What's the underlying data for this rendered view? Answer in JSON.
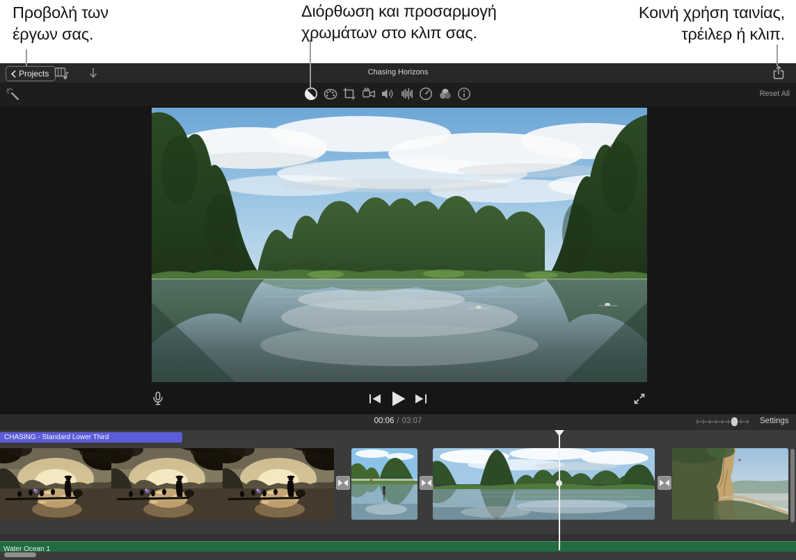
{
  "callouts": {
    "projects": {
      "line1": "Προβολή των",
      "line2": "έργων σας."
    },
    "color": {
      "line1": "Διόρθωση και προσαρμογή",
      "line2": "χρωμάτων στο κλιπ σας."
    },
    "share": {
      "line1": "Κοινή χρήση ταινίας,",
      "line2": "τρέιλερ ή κλιπ."
    }
  },
  "titlebar": {
    "back_label": "Projects",
    "project_title": "Chasing Horizons",
    "icons": [
      "back-chevron-icon",
      "media-browser-icon",
      "import-arrow-icon",
      "share-icon"
    ]
  },
  "adjustbar": {
    "reset_label": "Reset All",
    "icons": [
      "enhance-wand-icon",
      "color-balance-icon",
      "color-correction-icon",
      "crop-icon",
      "stabilization-icon",
      "volume-icon",
      "noise-reduction-icon",
      "speed-icon",
      "clip-filter-icon",
      "info-icon"
    ]
  },
  "transport": {
    "current_time": "00:06",
    "separator": "/",
    "total_time": "03:07",
    "icons": [
      "microphone-icon",
      "skip-back-icon",
      "play-icon",
      "skip-forward-icon",
      "fullscreen-icon"
    ]
  },
  "timeline": {
    "settings_label": "Settings",
    "title_clip": "CHASING - Standard Lower Third",
    "audio_clip": "Water Ocean 1",
    "zoom_slider_position_pct": 70,
    "clip_count": 4,
    "transition_count": 3
  },
  "colors": {
    "title_clip_purple": "#5d5cd8",
    "audio_clip_green": "#216b41"
  }
}
